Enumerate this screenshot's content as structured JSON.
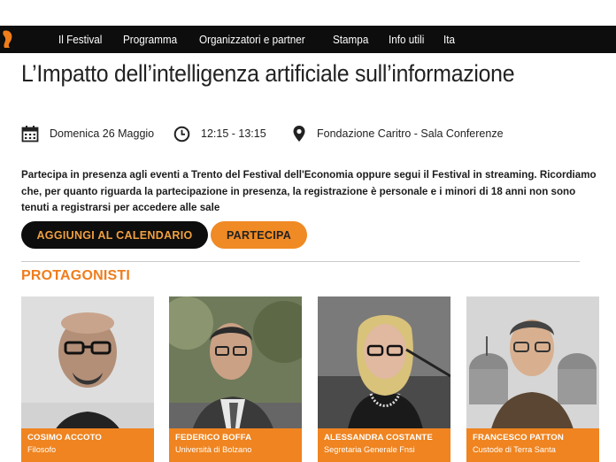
{
  "nav": {
    "items": [
      "Il Festival",
      "Programma",
      "Organizzatori e partner",
      "Stampa",
      "Info utili",
      "Ita"
    ]
  },
  "event": {
    "title": "L’Impatto dell’intelligenza artificiale sull’informazione",
    "date": "Domenica 26 Maggio",
    "time": "12:15 - 13:15",
    "location": "Fondazione Caritro - Sala Conferenze",
    "intro": "Partecipa in presenza agli eventi a Trento del Festival dell'Economia oppure segui il Festival in streaming. Ricordiamo che, per quanto riguarda la partecipazione in presenza, la registrazione è personale e i minori di 18 anni non sono tenuti a registrarsi per accedere alle sale"
  },
  "buttons": {
    "calendar": "AGGIUNGI AL CALENDARIO",
    "participate": "PARTECIPA"
  },
  "protagonists": {
    "heading": "PROTAGONISTI",
    "items": [
      {
        "name": "COSIMO ACCOTO",
        "role": "Filosofo"
      },
      {
        "name": "FEDERICO BOFFA",
        "role": "Università di Bolzano"
      },
      {
        "name": "ALESSANDRA COSTANTE",
        "role": "Segretaria Generale Fnsi"
      },
      {
        "name": "FRANCESCO PATTON",
        "role": "Custode di Terra Santa"
      }
    ]
  },
  "colors": {
    "accent": "#ef7d1c",
    "nav_bg": "#0d0d0d",
    "button_dark_text": "#f0a040"
  },
  "icons": [
    "calendar-icon",
    "clock-icon",
    "location-pin-icon"
  ]
}
